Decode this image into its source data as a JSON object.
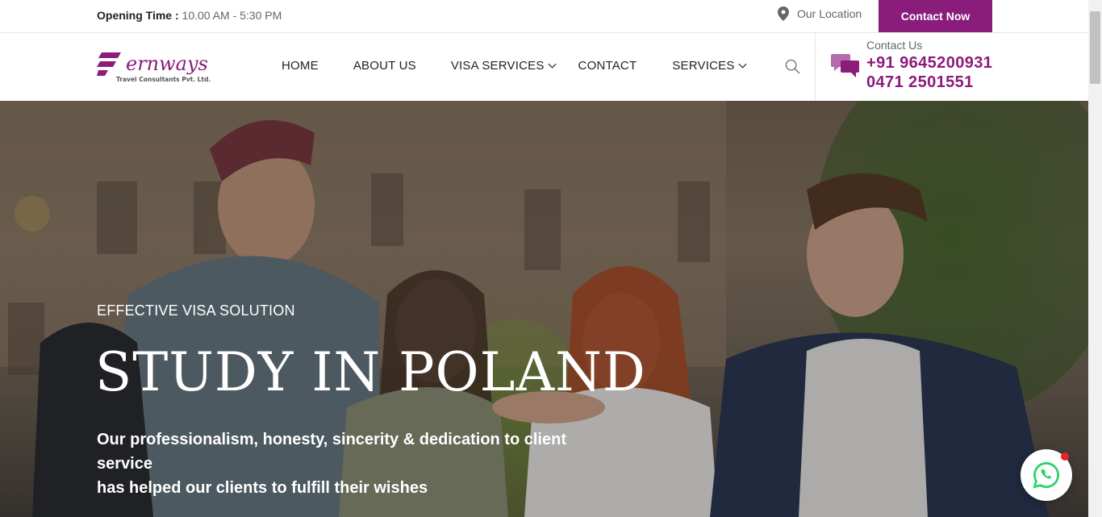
{
  "topbar": {
    "opening_label": "Opening Time :",
    "opening_value": "10.00 AM - 5:30 PM",
    "location_label": "Our Location",
    "contact_button": "Contact Now"
  },
  "brand": {
    "name": "Fernways",
    "tagline": "Travel Consultants Pvt. Ltd.",
    "color": "#8a1c7c"
  },
  "nav": {
    "items": [
      {
        "label": "HOME"
      },
      {
        "label": "ABOUT US"
      },
      {
        "label": "VISA SERVICES"
      },
      {
        "label": "CONTACT"
      },
      {
        "label": "SERVICES"
      }
    ]
  },
  "contact": {
    "label": "Contact Us",
    "phone1": "+91 9645200931",
    "phone2": "0471 2501551"
  },
  "hero": {
    "eyebrow": "EFFECTIVE VISA SOLUTION",
    "title": "STUDY IN POLAND",
    "text_line1": "Our professionalism, honesty, sincerity & dedication to client service",
    "text_line2": "has helped our clients to fulfill their wishes"
  },
  "icons": {
    "location": "map-pin-icon",
    "search": "search-icon",
    "chat": "chat-bubbles-icon",
    "whatsapp": "whatsapp-icon",
    "chevron": "chevron-down-icon"
  },
  "colors": {
    "accent": "#8a1c7c",
    "whatsapp": "#25d366",
    "notification": "#e8212a"
  }
}
